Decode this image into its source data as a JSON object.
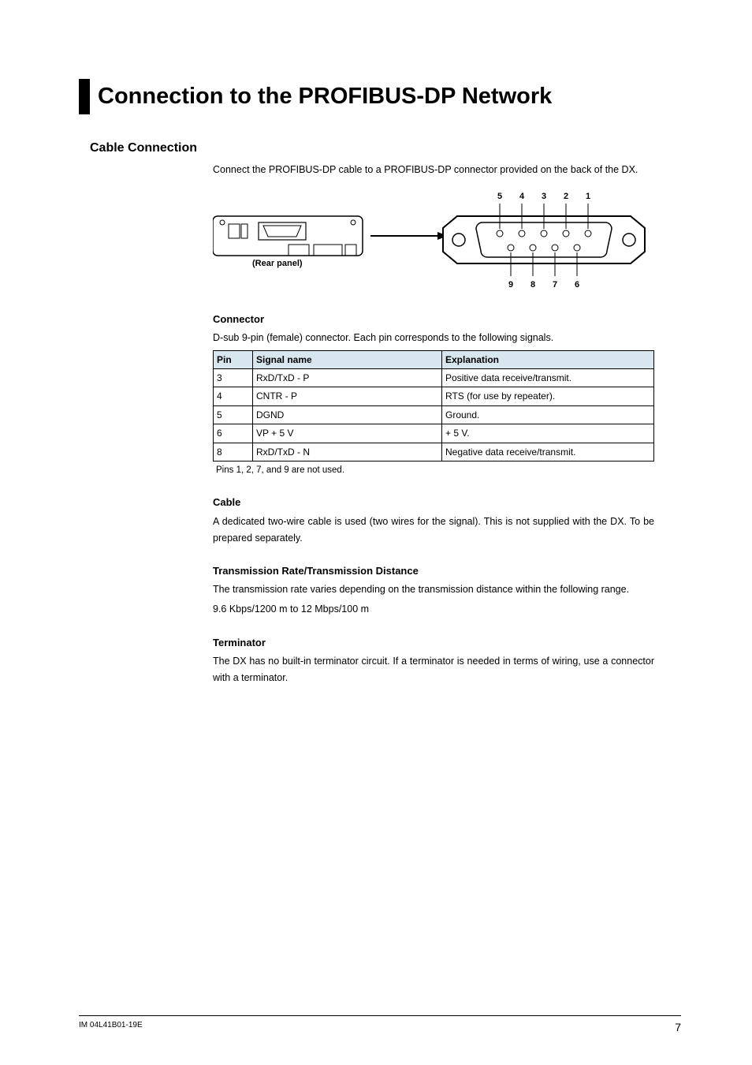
{
  "page_title": "Connection to the PROFIBUS-DP Network",
  "section_heading": "Cable Connection",
  "intro": "Connect the PROFIBUS-DP cable to a PROFIBUS-DP connector provided on the back of the DX.",
  "diagram": {
    "rear_panel_label": "(Rear panel)",
    "top_pins": [
      "5",
      "4",
      "3",
      "2",
      "1"
    ],
    "bottom_pins": [
      "9",
      "8",
      "7",
      "6"
    ]
  },
  "connector": {
    "heading": "Connector",
    "desc": "D-sub 9-pin (female) connector. Each pin corresponds to the following signals.",
    "headers": {
      "pin": "Pin",
      "signal": "Signal name",
      "expl": "Explanation"
    },
    "rows": [
      {
        "pin": "3",
        "signal": "RxD/TxD - P",
        "expl": "Positive data receive/transmit."
      },
      {
        "pin": "4",
        "signal": "CNTR - P",
        "expl": "RTS (for use by repeater)."
      },
      {
        "pin": "5",
        "signal": "DGND",
        "expl": "Ground."
      },
      {
        "pin": "6",
        "signal": "VP + 5 V",
        "expl": "+ 5 V."
      },
      {
        "pin": "8",
        "signal": "RxD/TxD - N",
        "expl": "Negative data receive/transmit."
      }
    ],
    "note": "Pins 1, 2, 7, and 9 are not used."
  },
  "cable": {
    "heading": "Cable",
    "desc": "A dedicated two-wire cable is used (two wires for the signal). This is not supplied with the DX. To be prepared separately."
  },
  "rate": {
    "heading": "Transmission Rate/Transmission Distance",
    "desc": "The transmission rate varies depending on the transmission distance within the following range.",
    "range": "9.6 Kbps/1200 m to 12 Mbps/100 m"
  },
  "terminator": {
    "heading": "Terminator",
    "desc": "The DX has no built-in terminator circuit. If a terminator is needed in terms of wiring, use a connector with a terminator."
  },
  "footer": {
    "doc_id": "IM 04L41B01-19E",
    "page": "7"
  }
}
